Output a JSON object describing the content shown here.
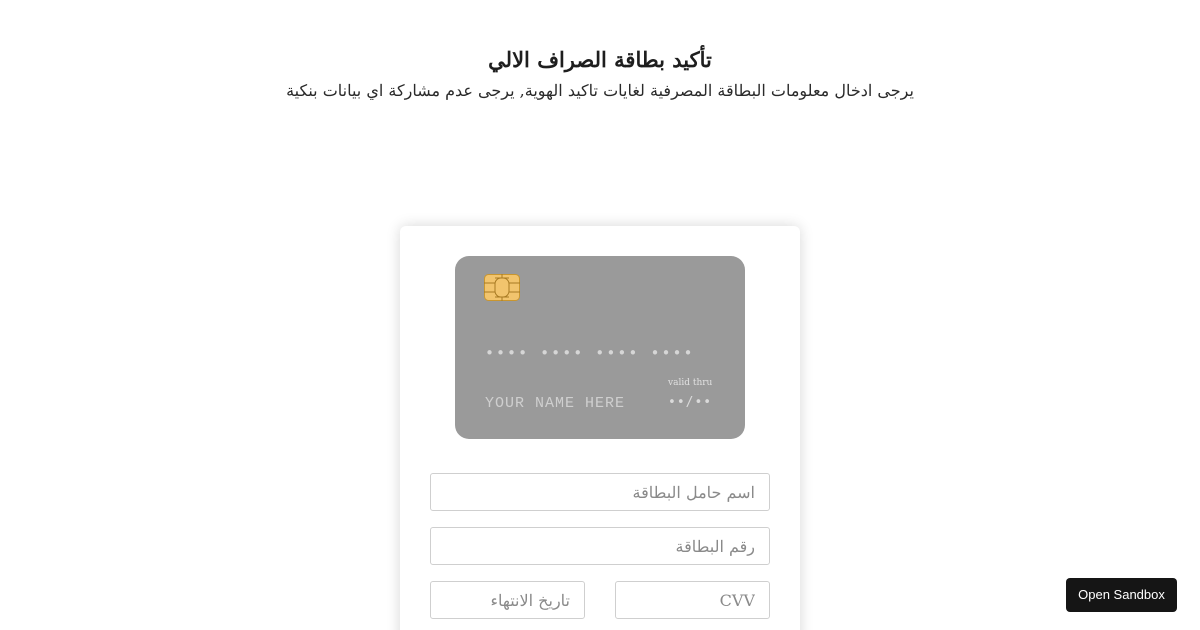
{
  "header": {
    "title": "تأكيد بطاقة الصراف الالي",
    "subtitle": "يرجى ادخال معلومات البطاقة المصرفية لغايات تاكيد الهوية, يرجى عدم مشاركة اي بيانات بنكية"
  },
  "card": {
    "number_mask": "•••• •••• •••• ••••",
    "valid_label": "valid thru",
    "name_placeholder": "YOUR NAME HERE",
    "expiry_mask": "••/••",
    "chip_color": "#f2c46d",
    "background": "#9a9a9a"
  },
  "form": {
    "holder_name_placeholder": "اسم حامل البطاقة",
    "card_number_placeholder": "رقم البطاقة",
    "expiry_placeholder": "تاريخ الانتهاء",
    "cvv_placeholder": "CVV"
  },
  "sandbox": {
    "label": "Open Sandbox"
  }
}
